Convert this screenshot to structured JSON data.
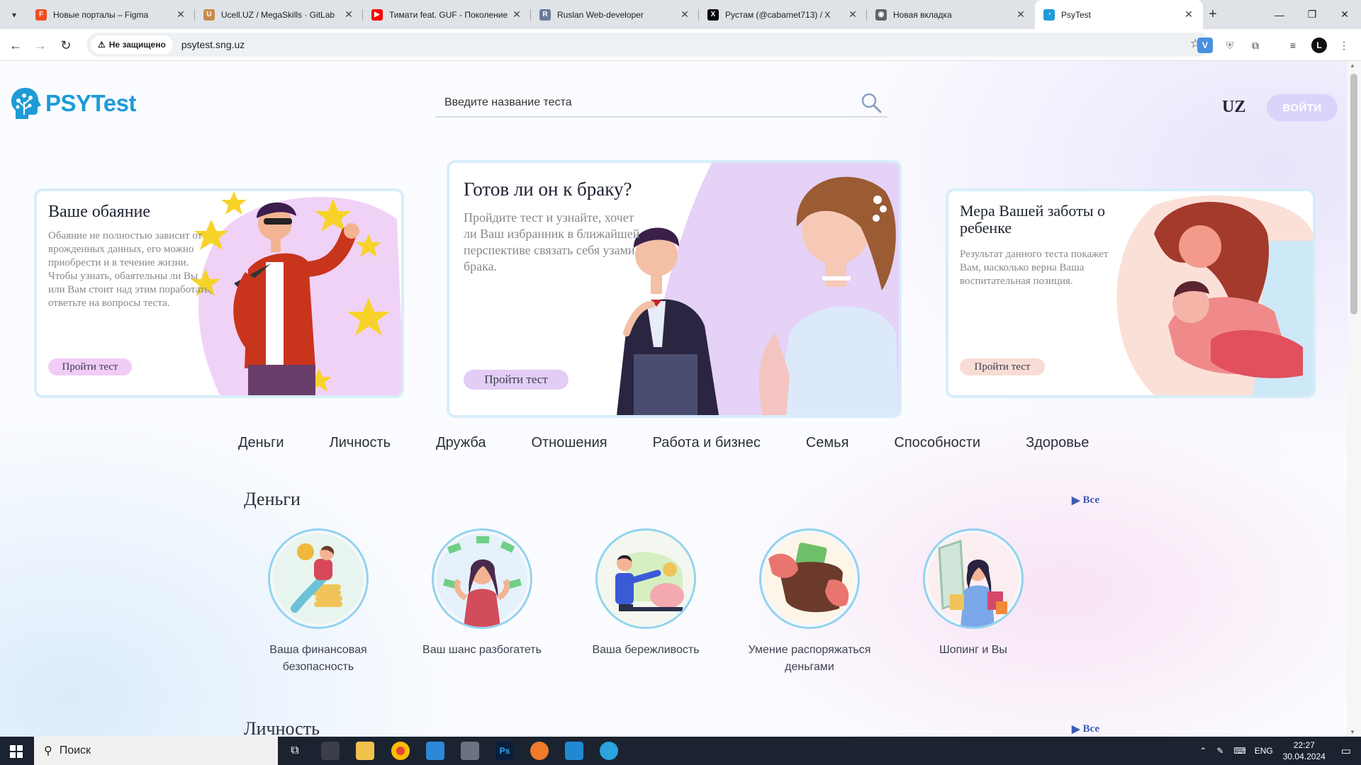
{
  "browser": {
    "tabs": [
      {
        "title": "Новые порталы – Figma",
        "color": "#f24e1e",
        "glyph": "F"
      },
      {
        "title": "Ucell.UZ / MegaSkills · GitLab",
        "color": "#c98b4a",
        "glyph": "U"
      },
      {
        "title": "Тимати feat. GUF - Поколение",
        "color": "#ff0000",
        "glyph": "▶"
      },
      {
        "title": "Ruslan Web-developer",
        "color": "#6c7a99",
        "glyph": "R"
      },
      {
        "title": "Рустам (@cabarnet713) / X",
        "color": "#000000",
        "glyph": "X"
      },
      {
        "title": "Новая вкладка",
        "color": "#5f6368",
        "glyph": "◉"
      },
      {
        "title": "PsyTest",
        "color": "#1e9bd7",
        "glyph": "◔"
      }
    ],
    "security_label": "Не защищено",
    "url": "psytest.sng.uz"
  },
  "header": {
    "logo_text": "PSYTest",
    "search_placeholder": "Введите название теста",
    "lang": "UZ",
    "login": "ВОЙТИ"
  },
  "featured": [
    {
      "title": "Ваше обаяние",
      "text": "Обаяние не полностью зависит от врожденных данных, его можно приобрести и в течение жизни. Чтобы узнать, обаятельны ли Вы или Вам стоит над этим поработать, ответьте на вопросы теста.",
      "button": "Пройти тест",
      "btn_color": "#f1ccf5"
    },
    {
      "title": "Готов ли он к браку?",
      "text": "Пройдите тест и узнайте, хочет ли Ваш избранник в ближайшей перспективе связать себя узами брака.",
      "button": "Пройти тест",
      "btn_color": "#e3cdf6"
    },
    {
      "title": "Мера Вашей заботы о ребенке",
      "text": "Результат данного теста покажет Вам, насколько верна Ваша воспитательная позиция.",
      "button": "Пройти тест",
      "btn_color": "#f8dcd6"
    }
  ],
  "categories": [
    "Деньги",
    "Личность",
    "Дружба",
    "Отношения",
    "Работа и бизнес",
    "Семья",
    "Способности",
    "Здоровье"
  ],
  "sections": [
    {
      "title": "Деньги",
      "all": "Все",
      "tests": [
        {
          "label": "Ваша финансовая безопасность",
          "icon": "coins-woman-icon"
        },
        {
          "label": "Ваш шанс разбогатеть",
          "icon": "money-rain-icon"
        },
        {
          "label": "Ваша бережливость",
          "icon": "piggy-bank-icon"
        },
        {
          "label": "Умение распоряжаться деньгами",
          "icon": "wallet-icon"
        },
        {
          "label": "Шопинг и Вы",
          "icon": "shopping-icon"
        }
      ]
    },
    {
      "title": "Личность",
      "all": "Все"
    }
  ],
  "taskbar": {
    "search": "Поиск",
    "lang": "ENG",
    "time": "22:27",
    "date": "30.04.2024"
  }
}
